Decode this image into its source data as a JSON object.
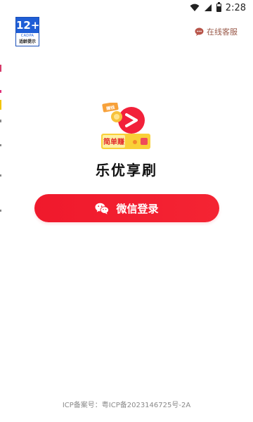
{
  "status_bar": {
    "time": "2:28"
  },
  "age_badge": {
    "rating": "12+",
    "org": "CADPA",
    "hint": "适龄提示"
  },
  "service": {
    "label": "在线客服",
    "icon": "chat-bubble-icon"
  },
  "logo": {
    "tag": "赚钱",
    "banner": "简单赚"
  },
  "app": {
    "name": "乐优享刷"
  },
  "login": {
    "label": "微信登录",
    "icon": "wechat-icon"
  },
  "footer": {
    "icp": "ICP备案号：粤ICP备2023146725号-2A"
  },
  "colors": {
    "primary_red": "#f0192c",
    "badge_blue": "#1f5ed6",
    "service_text": "#9a5a4a",
    "footer_text": "#8a8a8a"
  }
}
